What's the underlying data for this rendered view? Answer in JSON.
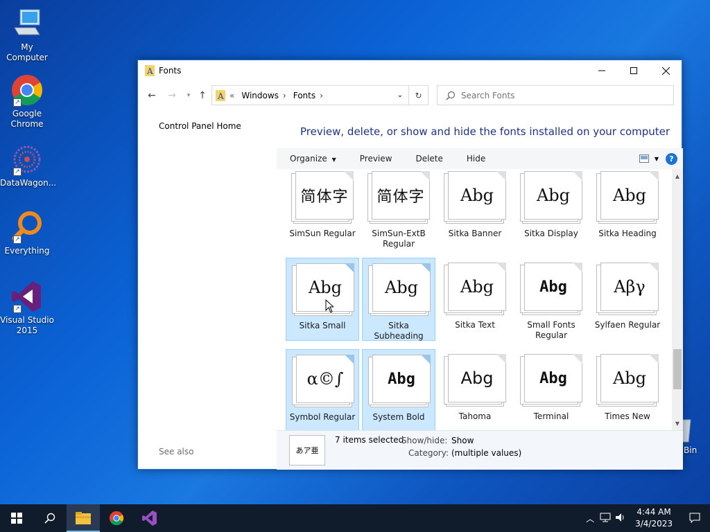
{
  "desktop": {
    "icons": [
      {
        "label": "My Computer"
      },
      {
        "label": "Google Chrome"
      },
      {
        "label": "DataWagon..."
      },
      {
        "label": "Everything"
      },
      {
        "label": "Visual Studio 2015"
      }
    ],
    "recycle_partial": "Bin"
  },
  "window": {
    "title": "Fonts",
    "address": {
      "prefix": "«",
      "segments": [
        "Windows",
        "Fonts"
      ]
    },
    "search": {
      "placeholder": "Search Fonts",
      "value": ""
    },
    "left_pane": {
      "home": "Control Panel Home",
      "see_also": "See also"
    },
    "heading": "Preview, delete, or show and hide the fonts installed on your computer",
    "toolbar": {
      "organize": "Organize",
      "preview": "Preview",
      "delete": "Delete",
      "hide": "Hide"
    },
    "fonts": [
      {
        "name": "SimSun Regular",
        "sample": "简体字",
        "style": "cjk",
        "selected": false
      },
      {
        "name": "SimSun-ExtB Regular",
        "sample": "简体字",
        "style": "cjk",
        "selected": false
      },
      {
        "name": "Sitka Banner",
        "sample": "Abg",
        "style": "serif",
        "selected": false
      },
      {
        "name": "Sitka Display",
        "sample": "Abg",
        "style": "serif",
        "selected": false
      },
      {
        "name": "Sitka Heading",
        "sample": "Abg",
        "style": "serif",
        "selected": false
      },
      {
        "name": "Sitka Small",
        "sample": "Abg",
        "style": "serif",
        "selected": true
      },
      {
        "name": "Sitka Subheading",
        "sample": "Abg",
        "style": "serif",
        "selected": true
      },
      {
        "name": "Sitka Text",
        "sample": "Abg",
        "style": "serif",
        "selected": false
      },
      {
        "name": "Small Fonts Regular",
        "sample": "Abg",
        "style": "pix",
        "selected": false
      },
      {
        "name": "Sylfaen Regular",
        "sample": "Αβγ",
        "style": "serif",
        "selected": false
      },
      {
        "name": "Symbol Regular",
        "sample": "α©∫",
        "style": "serif",
        "selected": true
      },
      {
        "name": "System Bold",
        "sample": "Abg",
        "style": "pix",
        "selected": true
      },
      {
        "name": "Tahoma",
        "sample": "Abg",
        "style": "sans",
        "selected": false
      },
      {
        "name": "Terminal",
        "sample": "Abg",
        "style": "pix",
        "selected": false
      },
      {
        "name": "Times New",
        "sample": "Abg",
        "style": "serif",
        "selected": false
      }
    ],
    "details": {
      "thumb_text": "あア亜",
      "selected_count": "7 items selected",
      "show_hide_label": "Show/hide:",
      "show_hide_value": "Show",
      "category_label": "Category:",
      "category_value": "(multiple values)"
    }
  },
  "taskbar": {
    "time": "4:44 AM",
    "date": "3/4/2023"
  }
}
